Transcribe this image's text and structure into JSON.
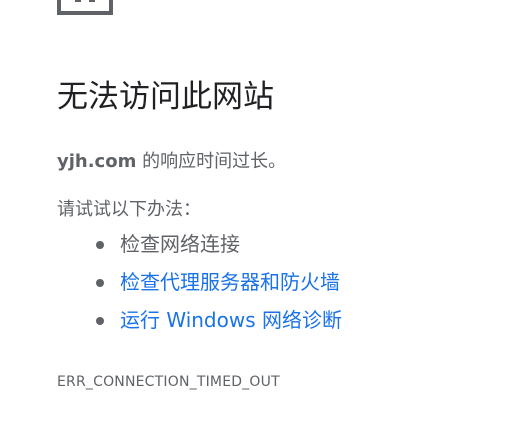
{
  "error": {
    "icon": "broken-page-icon",
    "title": "无法访问此网站",
    "host": "yjh.com",
    "summary_suffix": " 的响应时间过长。",
    "suggestions_heading": "请试试以下办法：",
    "suggestions": [
      {
        "label": "检查网络连接",
        "is_link": false
      },
      {
        "label": "检查代理服务器和防火墙",
        "is_link": true
      },
      {
        "label": "运行 Windows 网络诊断",
        "is_link": true
      }
    ],
    "code": "ERR_CONNECTION_TIMED_OUT"
  },
  "colors": {
    "background": "#ffffff",
    "title": "#202124",
    "body_text": "#5f6368",
    "link": "#1a73e8"
  }
}
